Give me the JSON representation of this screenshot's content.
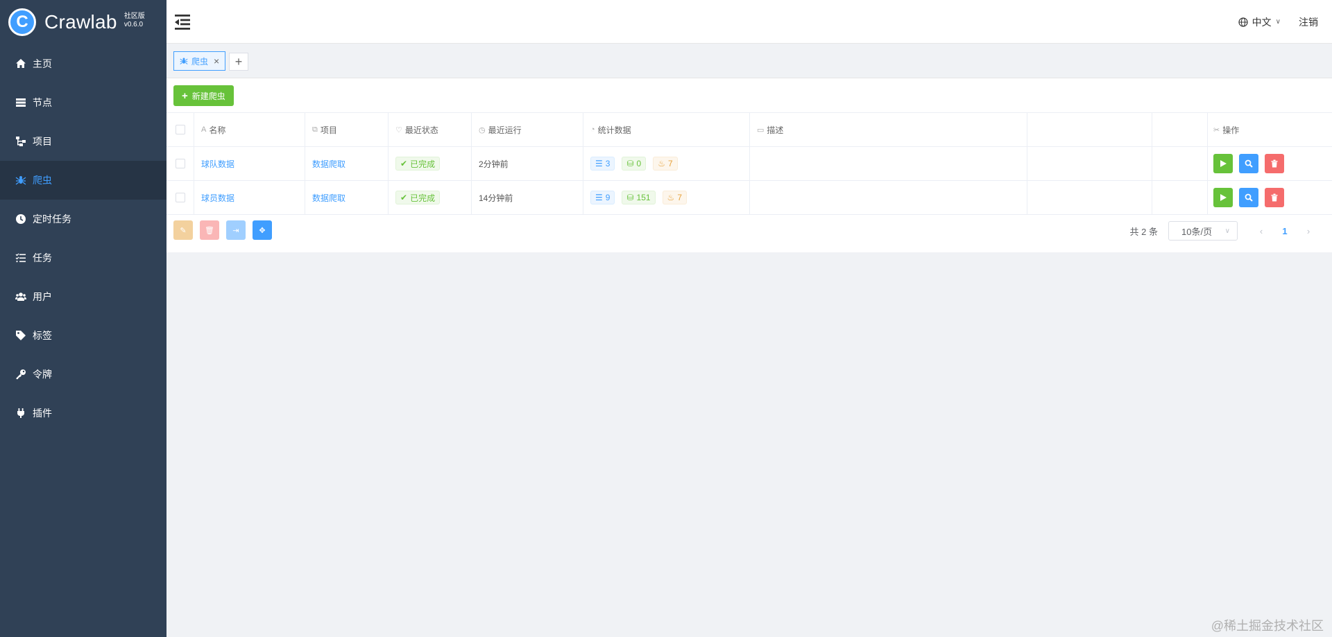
{
  "brand": {
    "logo_letter": "C",
    "name": "Crawlab",
    "edition": "社区版",
    "version": "v0.6.0"
  },
  "sidebar": {
    "items": [
      {
        "label": "主页",
        "icon": "home-icon",
        "active": false
      },
      {
        "label": "节点",
        "icon": "server-icon",
        "active": false
      },
      {
        "label": "项目",
        "icon": "project-tree-icon",
        "active": false
      },
      {
        "label": "爬虫",
        "icon": "spider-icon",
        "active": true
      },
      {
        "label": "定时任务",
        "icon": "clock-icon",
        "active": false
      },
      {
        "label": "任务",
        "icon": "task-list-icon",
        "active": false
      },
      {
        "label": "用户",
        "icon": "users-icon",
        "active": false
      },
      {
        "label": "标签",
        "icon": "tag-icon",
        "active": false
      },
      {
        "label": "令牌",
        "icon": "key-icon",
        "active": false
      },
      {
        "label": "插件",
        "icon": "plug-icon",
        "active": false
      }
    ]
  },
  "header": {
    "language": "中文",
    "logout": "注销"
  },
  "tabs": [
    {
      "label": "爬虫",
      "icon": "spider-icon",
      "close": "×"
    }
  ],
  "tab_add": "+",
  "toolbar": {
    "new_spider": "新建爬虫"
  },
  "table": {
    "headers": {
      "name": "名称",
      "project": "项目",
      "status": "最近状态",
      "last_run": "最近运行",
      "stats": "统计数据",
      "description": "描述",
      "actions": "操作"
    },
    "rows": [
      {
        "name": "球队数据",
        "project": "数据爬取",
        "status": "已完成",
        "last_run": "2分钟前",
        "stats": {
          "tasks": "3",
          "results": "0",
          "errors": "7"
        },
        "description": ""
      },
      {
        "name": "球员数据",
        "project": "数据爬取",
        "status": "已完成",
        "last_run": "14分钟前",
        "stats": {
          "tasks": "9",
          "results": "151",
          "errors": "7"
        },
        "description": ""
      }
    ]
  },
  "pagination": {
    "total": "共 2 条",
    "page_size": "10条/页",
    "current_page": "1",
    "prev": "‹",
    "next": "›"
  },
  "watermark": "@稀土掘金技术社区",
  "colors": {
    "sidebar_bg": "#304156",
    "primary": "#409eff",
    "success": "#67c23a",
    "danger": "#f56c6c",
    "warning": "#e6a23c"
  }
}
